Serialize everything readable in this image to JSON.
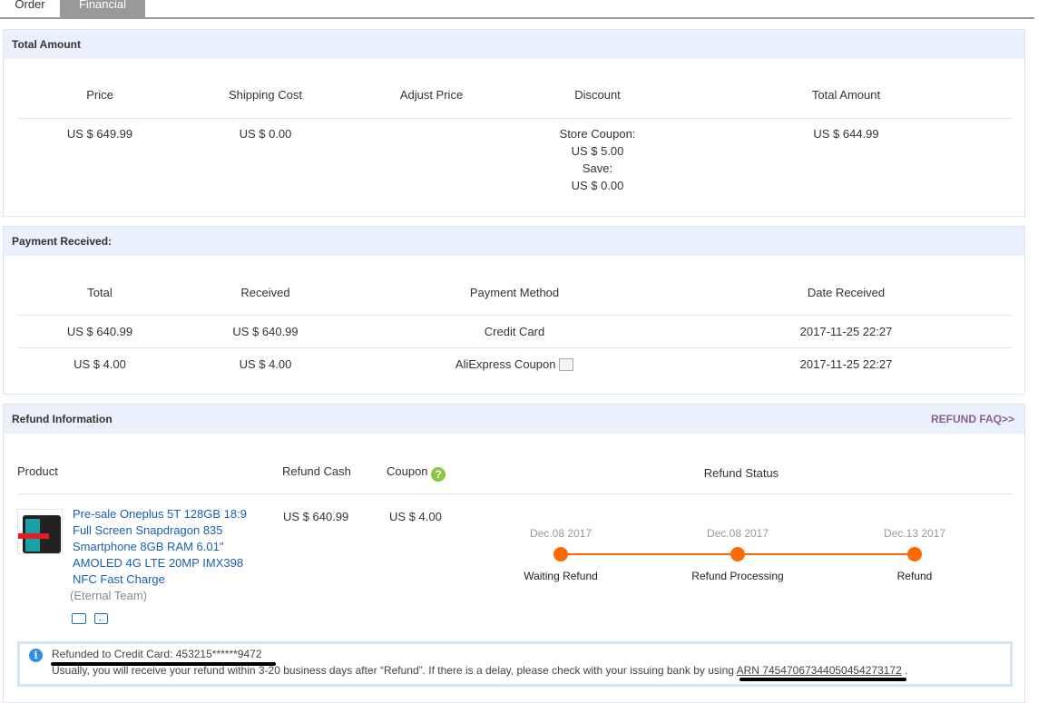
{
  "tabs": {
    "order": "Order",
    "financial": "Financial"
  },
  "total_amount": {
    "title": "Total Amount",
    "headers": [
      "Price",
      "Shipping Cost",
      "Adjust Price",
      "Discount",
      "Total Amount"
    ],
    "price": "US $ 649.99",
    "shipping": "US $ 0.00",
    "adjust": "",
    "discount": [
      "Store Coupon:",
      "US $ 5.00",
      "Save:",
      "US $ 0.00"
    ],
    "total": "US $ 644.99"
  },
  "payment": {
    "title": "Payment Received:",
    "headers": [
      "Total",
      "Received",
      "Payment Method",
      "Date Received"
    ],
    "rows": [
      [
        "US $ 640.99",
        "US $ 640.99",
        "Credit Card",
        "2017-11-25 22:27"
      ],
      [
        "US $ 4.00",
        "US $ 4.00",
        "AliExpress Coupon",
        "2017-11-25 22:27"
      ]
    ]
  },
  "refund": {
    "title": "Refund Information",
    "faq": "REFUND FAQ>>",
    "headers": {
      "product": "Product",
      "cash": "Refund Cash",
      "coupon": "Coupon",
      "status": "Refund Status"
    },
    "product_name": "Pre-sale Oneplus 5T 128GB 18:9 Full Screen Snapdragon 835 Smartphone 8GB RAM 6.01\" AMOLED 4G LTE 20MP IMX398 NFC Fast Charge",
    "store": "(Eternal Team)",
    "cash": "US $ 640.99",
    "coupon": "US $ 4.00",
    "steps": [
      {
        "date": "Dec.08 2017",
        "label": "Waiting Refund"
      },
      {
        "date": "Dec.08 2017",
        "label": "Refund Processing"
      },
      {
        "date": "Dec.13 2017",
        "label": "Refund"
      }
    ],
    "notice_title": "Refunded to Credit Card: 453215******9472",
    "notice_text": "Usually, you will receive your refund within 3-20 business days after “Refund”. If there is a delay, please check with your issuing bank by using ",
    "arn": "ARN 74547067344050454273172",
    "notice_end": " ."
  },
  "colors": {
    "accent": "#ff6a00",
    "link": "#1a5fb4",
    "header_bg": "#eaf1fc"
  }
}
